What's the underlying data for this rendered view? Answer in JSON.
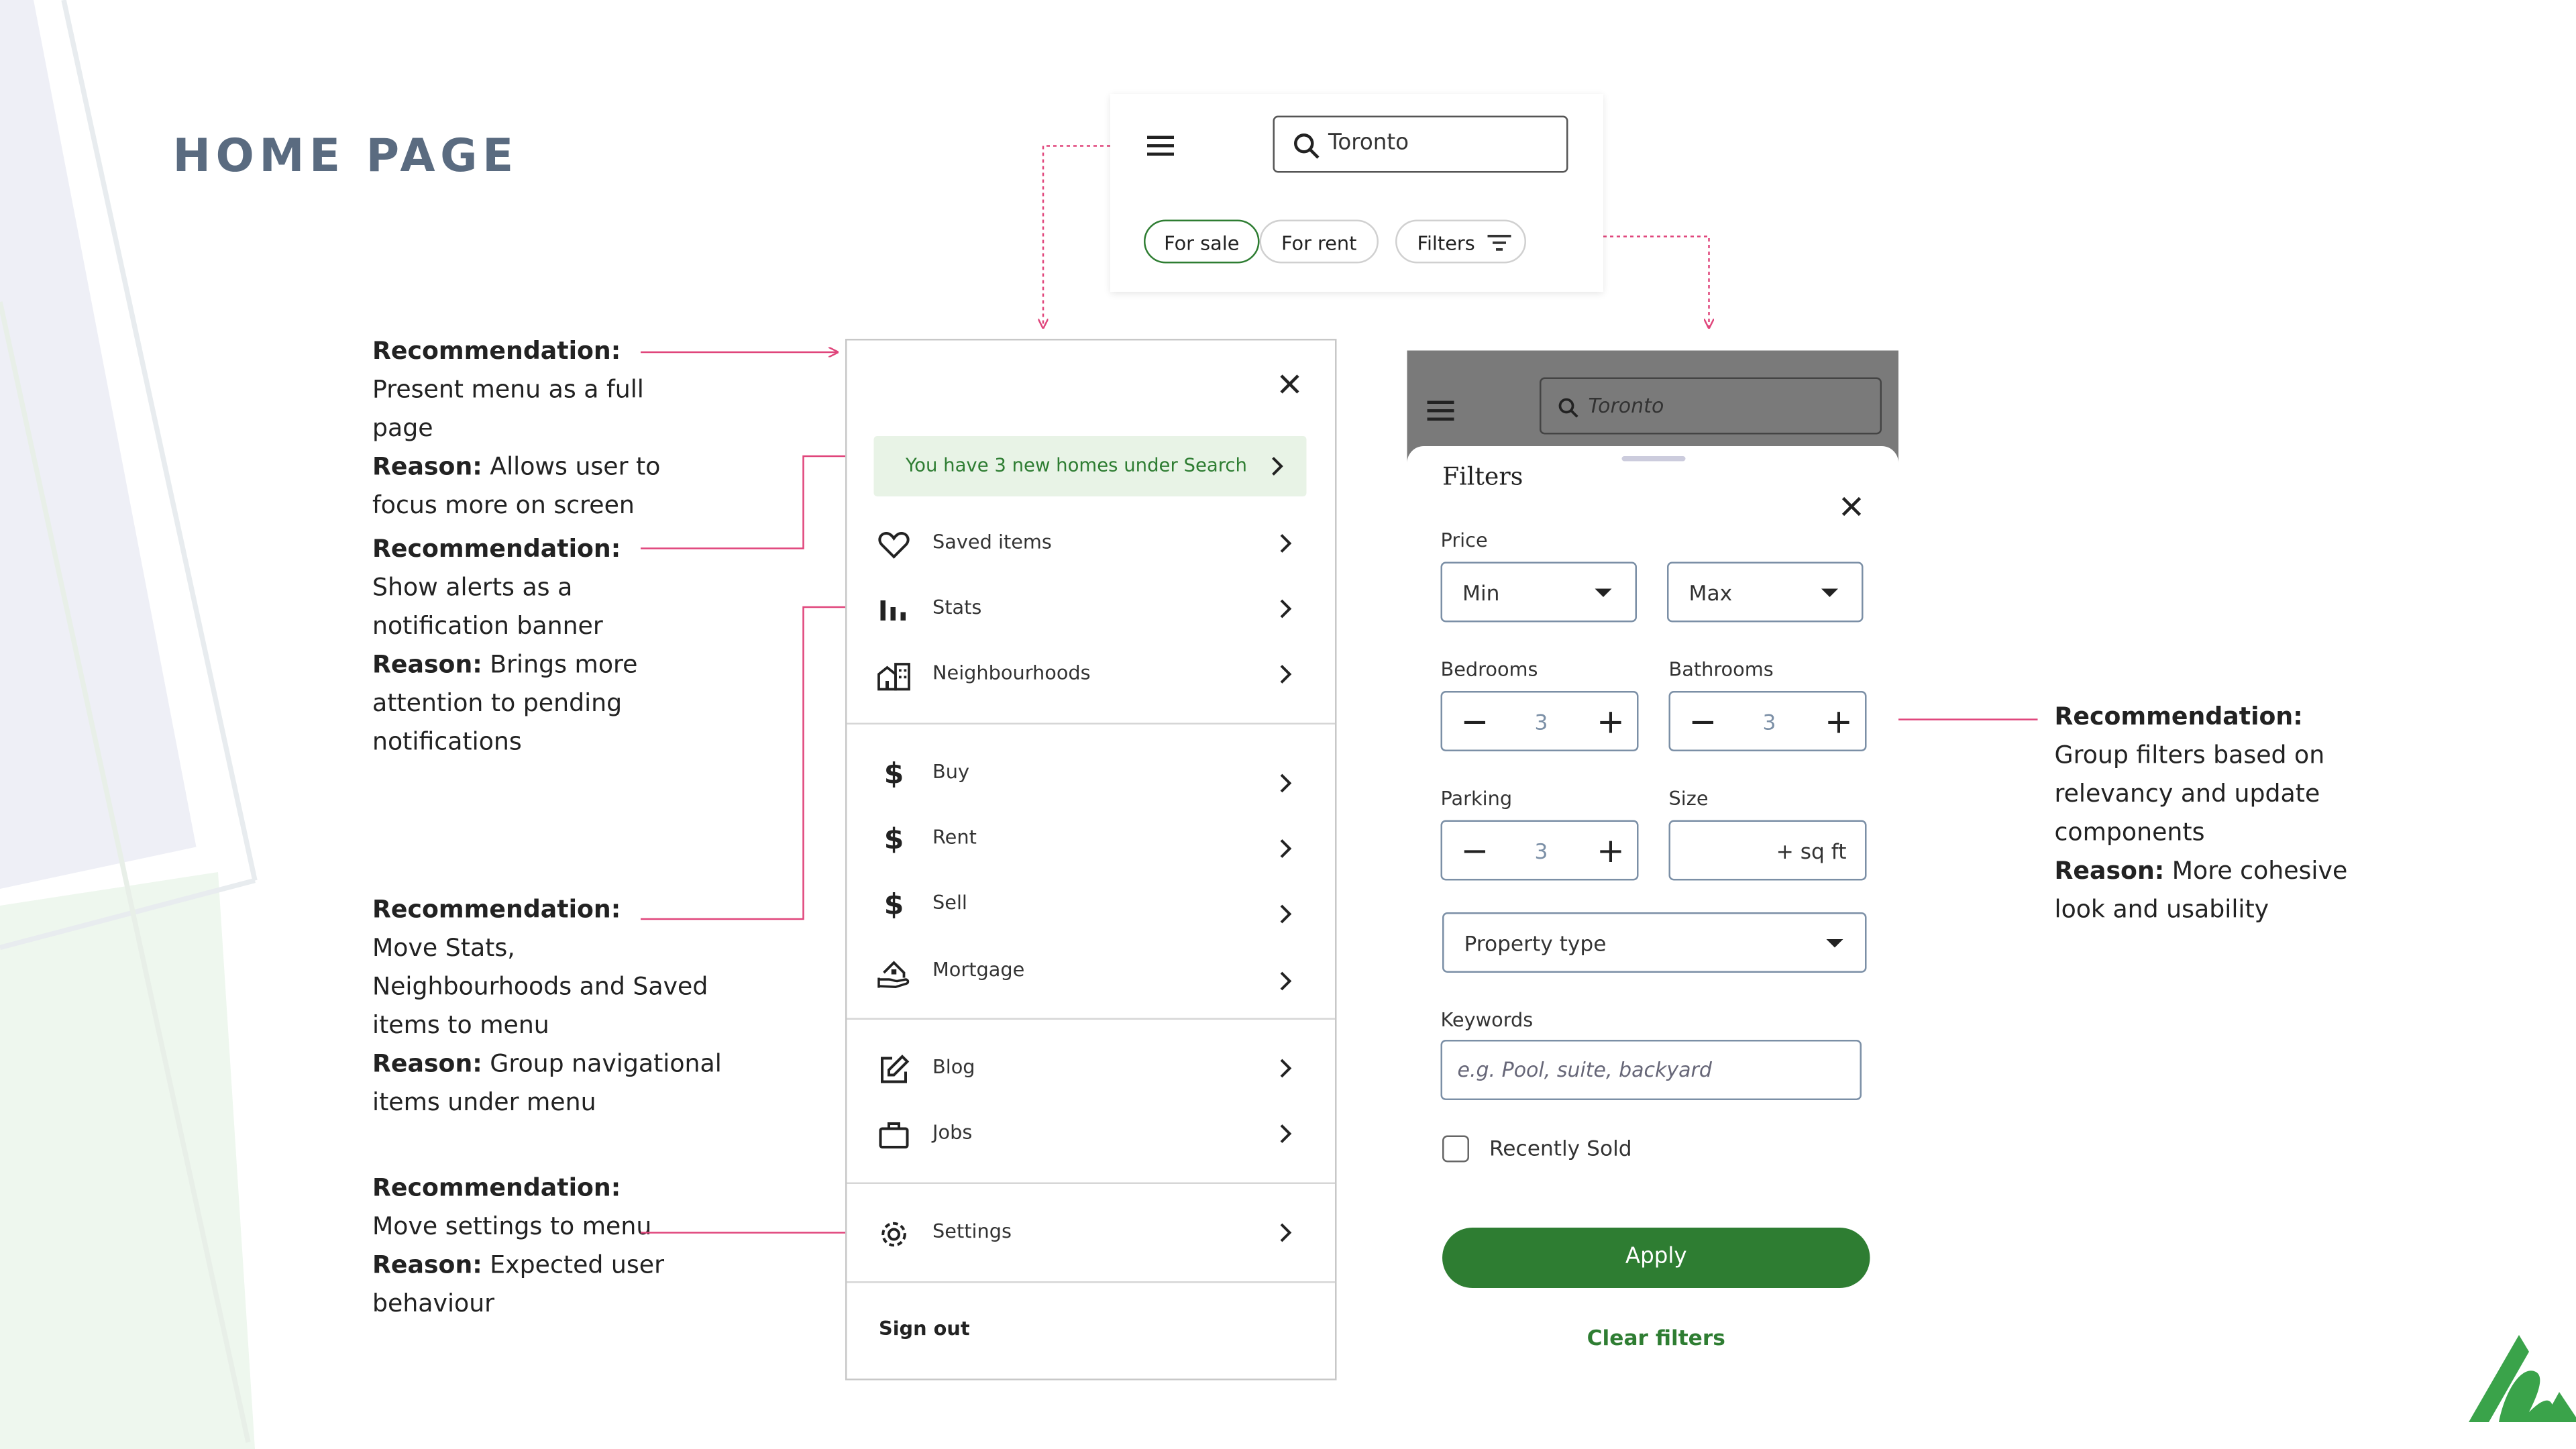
{
  "page_title": "HOME PAGE",
  "colors": {
    "title": "#5a6b80",
    "accent_green": "#2e7d32",
    "annotation_pink": "#e0457b",
    "banner_bg": "#e8f3e6",
    "banner_text": "#2e7d32",
    "overlay_gray": "#7a7a7a"
  },
  "annotations": [
    {
      "title": "Recommendation:",
      "lines": [
        "Present menu as a full",
        "page"
      ],
      "reason_label": "Reason:",
      "reason_lines": [
        " Allows user to",
        "focus more on screen"
      ]
    },
    {
      "title": "Recommendation:",
      "lines": [
        "Show alerts as a",
        "notification banner"
      ],
      "reason_label": "Reason:",
      "reason_lines": [
        " Brings more",
        "attention to pending",
        "notifications"
      ]
    },
    {
      "title": "Recommendation:",
      "lines": [
        "Move Stats,",
        "Neighbourhoods and Saved",
        "items to menu"
      ],
      "reason_label": "Reason:",
      "reason_lines": [
        " Group navigational",
        "items under menu"
      ]
    },
    {
      "title": "Recommendation:",
      "lines": [
        "Move settings to menu"
      ],
      "reason_label": "Reason:",
      "reason_lines": [
        " Expected user",
        "behaviour"
      ]
    },
    {
      "title": "Recommendation:",
      "lines": [
        "Group filters based on",
        "relevancy and update",
        "components"
      ],
      "reason_label": "Reason:",
      "reason_lines": [
        " More cohesive",
        "look and usability"
      ]
    }
  ],
  "header": {
    "menu_icon": "hamburger-icon",
    "search_value": "Toronto",
    "search_icon": "search-icon",
    "chips": {
      "for_sale": "For sale",
      "for_rent": "For rent",
      "filters": "Filters"
    }
  },
  "menu": {
    "close_icon": "close-icon",
    "banner": "You have 3 new homes under Search",
    "items": [
      {
        "label": "Saved items",
        "icon": "heart-icon"
      },
      {
        "label": "Stats",
        "icon": "bar-chart-icon"
      },
      {
        "label": "Neighbourhoods",
        "icon": "buildings-icon"
      },
      {
        "label": "Buy",
        "icon": "dollar-icon"
      },
      {
        "label": "Rent",
        "icon": "dollar-icon"
      },
      {
        "label": "Sell",
        "icon": "dollar-icon"
      },
      {
        "label": "Mortgage",
        "icon": "house-hand-icon"
      },
      {
        "label": "Blog",
        "icon": "edit-icon"
      },
      {
        "label": "Jobs",
        "icon": "briefcase-icon"
      },
      {
        "label": "Settings",
        "icon": "gear-icon"
      }
    ],
    "sign_out": "Sign out"
  },
  "filters": {
    "search_value": "Toronto",
    "title": "Filters",
    "price_label": "Price",
    "price_min": "Min",
    "price_max": "Max",
    "bedrooms_label": "Bedrooms",
    "bedrooms_value": "3",
    "bathrooms_label": "Bathrooms",
    "bathrooms_value": "3",
    "parking_label": "Parking",
    "parking_value": "3",
    "size_label": "Size",
    "size_value": "+ sq ft",
    "property_type": "Property type",
    "keywords_label": "Keywords",
    "keywords_placeholder": "e.g. Pool, suite, backyard",
    "recently_sold": "Recently Sold",
    "recently_sold_checked": false,
    "apply": "Apply",
    "clear": "Clear filters"
  }
}
